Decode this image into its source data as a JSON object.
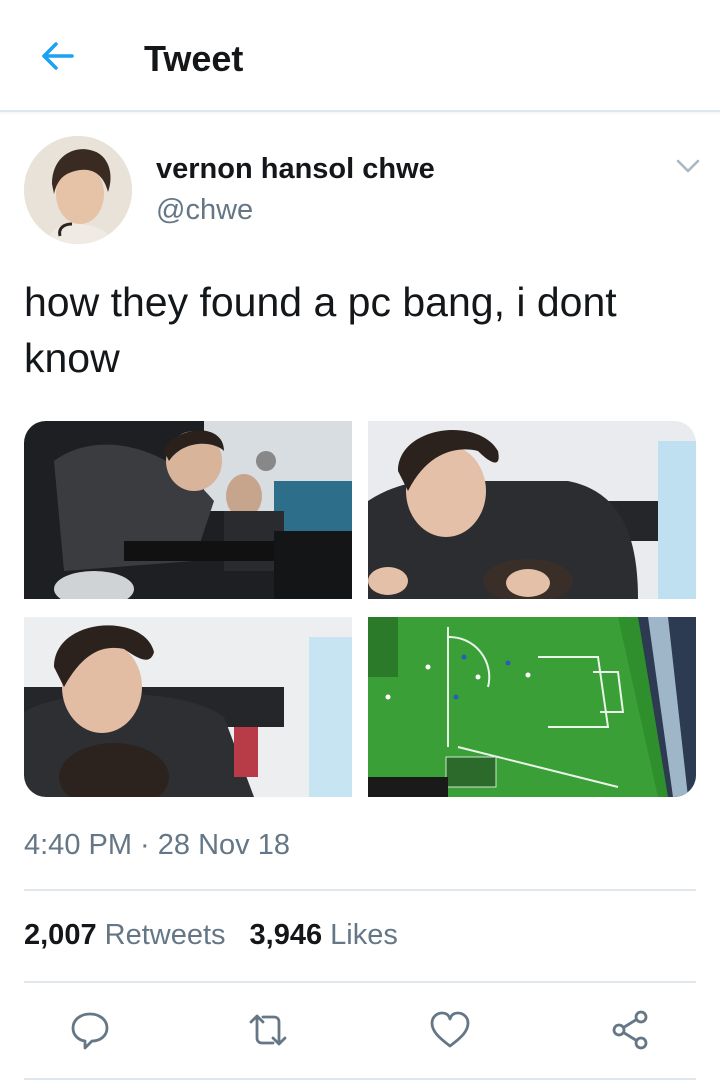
{
  "header": {
    "title": "Tweet",
    "back_icon": "arrow-left-icon"
  },
  "author": {
    "display_name": "vernon hansol chwe",
    "handle": "@chwe",
    "avatar": "avatar-photo",
    "menu_icon": "chevron-down-icon"
  },
  "tweet": {
    "text": "how they found a pc bang, i dont know",
    "media": [
      {
        "name": "photo-people-at-pc-bang"
      },
      {
        "name": "photo-man-leaning-forward"
      },
      {
        "name": "photo-man-behind-friend"
      },
      {
        "name": "photo-soccer-game-screen"
      }
    ],
    "timestamp": "4:40 PM · 28 Nov 18"
  },
  "stats": {
    "retweets_count": "2,007",
    "retweets_label": "Retweets",
    "likes_count": "3,946",
    "likes_label": "Likes"
  },
  "actions": [
    "reply-icon",
    "retweet-icon",
    "like-icon",
    "share-icon"
  ],
  "colors": {
    "accent": "#1da1f2",
    "text_primary": "#14171a",
    "text_secondary": "#657786",
    "divider": "#e1e8ed"
  }
}
